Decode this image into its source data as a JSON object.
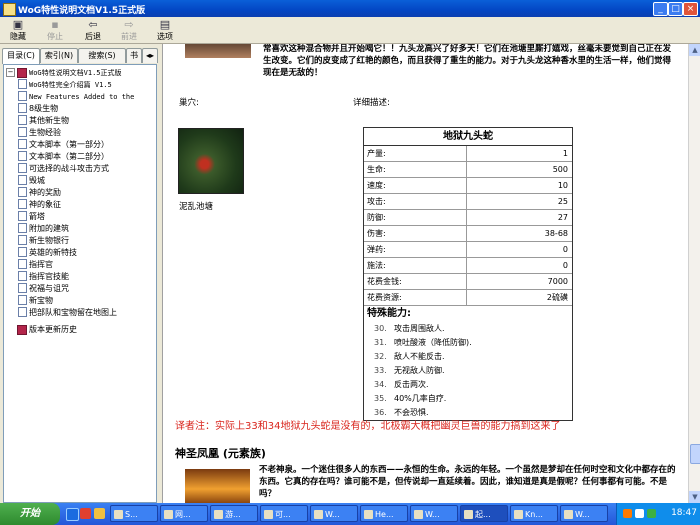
{
  "window": {
    "title": "WoG特性说明文档V1.5正式版",
    "controls": [
      "_",
      "□",
      "×"
    ]
  },
  "toolbar": [
    {
      "label": "隐藏",
      "icon": "hide-icon",
      "glyph": "▣",
      "enabled": true
    },
    {
      "label": "后退",
      "icon": "back-arrow-icon",
      "glyph": "⇦",
      "enabled": true
    },
    {
      "label": "前进",
      "icon": "forward-arrow-icon",
      "glyph": "⇨",
      "enabled": false
    },
    {
      "label": "选项",
      "icon": "options-icon",
      "glyph": "▤",
      "enabled": true
    }
  ],
  "toolbar_hidden_stub": "停止",
  "tabs": [
    {
      "label": "目录(C)",
      "active": true
    },
    {
      "label": "索引(N)",
      "active": false
    },
    {
      "label": "搜索(S)",
      "active": false
    },
    {
      "label": "书",
      "active": false
    }
  ],
  "tab_arrows": "◂▸",
  "tree": {
    "root": "WoG特性说明文档V1.5正式版",
    "items": [
      {
        "label": "WoG特性完全介绍篇 V1.5",
        "mono": true
      },
      {
        "label": "New Features Added to the",
        "mono": true
      },
      {
        "label": "8级生物",
        "mono": false
      },
      {
        "label": "其他新生物",
        "mono": false
      },
      {
        "label": "生物经验",
        "mono": false
      },
      {
        "label": "文本脚本（第一部分）",
        "mono": false
      },
      {
        "label": "文本脚本（第二部分）",
        "mono": false
      },
      {
        "label": "可选择的战斗攻击方式",
        "mono": false
      },
      {
        "label": "毁城",
        "mono": false
      },
      {
        "label": "神的奖励",
        "mono": false
      },
      {
        "label": "神的象征",
        "mono": false
      },
      {
        "label": "箭塔",
        "mono": false
      },
      {
        "label": "附加的建筑",
        "mono": false
      },
      {
        "label": "新生物银行",
        "mono": false
      },
      {
        "label": "英雄的新特技",
        "mono": false
      },
      {
        "label": "指挥官",
        "mono": false
      },
      {
        "label": "指挥官技能",
        "mono": false
      },
      {
        "label": "祝福与诅咒",
        "mono": false
      },
      {
        "label": "新宝物",
        "mono": false
      },
      {
        "label": "把部队和宝物留在地图上",
        "mono": false
      }
    ],
    "tail": "版本更新历史"
  },
  "content": {
    "intro": "常喜欢这种混合物并且开始喝它！！九头龙高兴了好多天！它们在池塘里厮打嬉戏，丝毫未要觉到自己正在发生改变。它们的皮变成了红艳的颜色，而且获得了重生的能力。对于九头龙这种香水里的生活一样，他们觉得现在是无敌的！",
    "lair_label": "巢穴:",
    "desc_label": "详细描述:",
    "lair_name": "泥乱池塘",
    "table": {
      "title": "地狱九头蛇",
      "rows": [
        {
          "k": "产量:",
          "v": "1"
        },
        {
          "k": "生命:",
          "v": "500"
        },
        {
          "k": "速度:",
          "v": "10"
        },
        {
          "k": "攻击:",
          "v": "25"
        },
        {
          "k": "防御:",
          "v": "27"
        },
        {
          "k": "伤害:",
          "v": "38-68"
        },
        {
          "k": "弹药:",
          "v": "0"
        },
        {
          "k": "施法:",
          "v": "0"
        },
        {
          "k": "花费金钱:",
          "v": "7000"
        },
        {
          "k": "花费资源:",
          "v": "2硫磺"
        }
      ],
      "abilities_title": "特殊能力:",
      "abilities": [
        {
          "n": "30.",
          "t": "攻击周围敌人."
        },
        {
          "n": "31.",
          "t": "喷吐酸液（降低防御)."
        },
        {
          "n": "32.",
          "t": "敌人不能反击."
        },
        {
          "n": "33.",
          "t": "无视敌人防御."
        },
        {
          "n": "34.",
          "t": "反击两次."
        },
        {
          "n": "35.",
          "t": "40%几率自疗."
        },
        {
          "n": "36.",
          "t": "不会恐惧."
        }
      ]
    },
    "note": "译者注：实际上33和34地狱九头蛇是没有的，北极霸大概把幽灵巨兽的能力搞到这来了",
    "section_title": "神圣凤凰 (元素族)",
    "phoenix_text": "不老神泉。一个迷住很多人的东西——永恒的生命。永远的年轻。一个虽然是梦却在任何时空和文化中都存在的东西。它真的存在吗？谁可能不是，但传说却一直延续着。因此，谁知道是真是假呢？任何事都有可能。不是吗？"
  },
  "taskbar": {
    "start": "开始",
    "tasks": [
      "S...",
      "网...",
      "游...",
      "可...",
      "W...",
      "He...",
      "W...",
      "起...",
      "Kn...",
      "W..."
    ],
    "clock": "18:47"
  }
}
